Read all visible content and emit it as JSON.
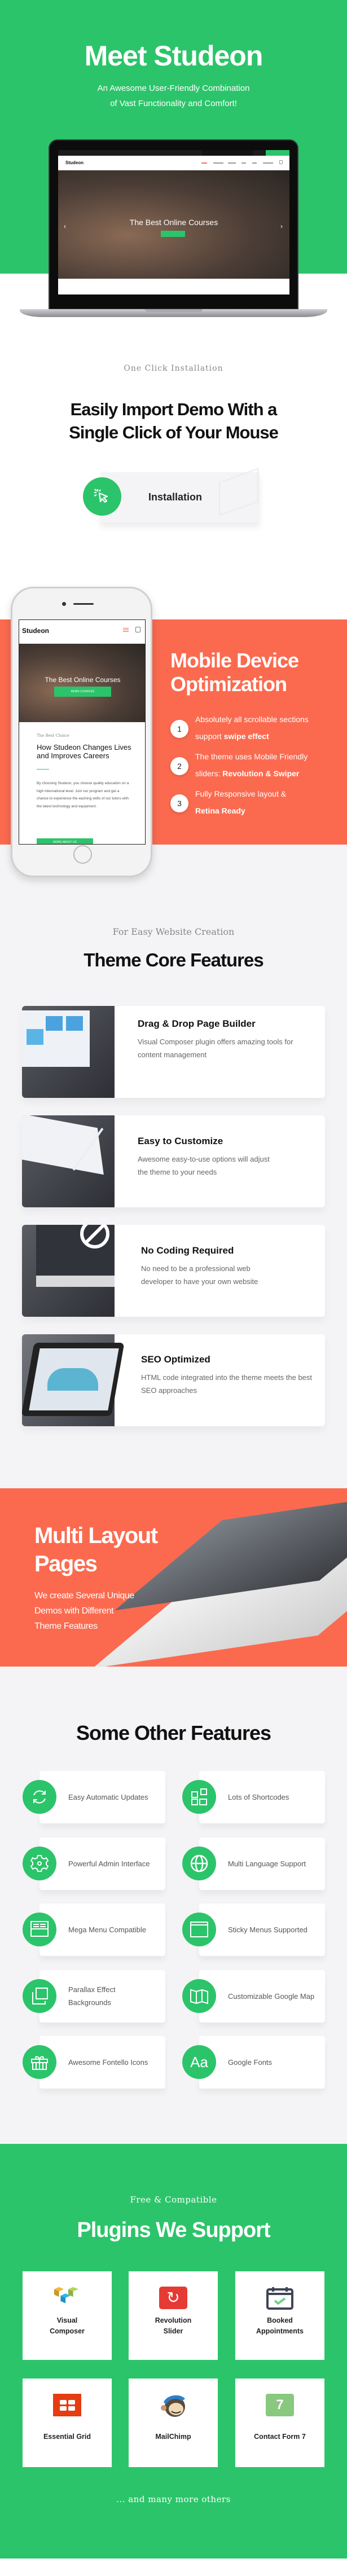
{
  "colors": {
    "green": "#2cc46a",
    "coral": "#fb6a4f",
    "background": "#f4f4f6"
  },
  "hero": {
    "title": "Meet Studeon",
    "subtitle_lines": [
      "An Awesome User-Friendly Combination",
      "of Vast Functionality  and Comfort!"
    ],
    "laptop": {
      "logo": "Studeon",
      "slide_title": "The Best Online Courses"
    }
  },
  "install": {
    "eyebrow": "One Click Installation",
    "heading_lines": [
      "Easily Import Demo With a",
      "Single Click of Your Mouse"
    ],
    "button_label": "Installation",
    "button_icon": "cursor-click-icon"
  },
  "mobile": {
    "phone": {
      "logo": "Studeon",
      "slide_title": "The Best Online Courses",
      "slide_button": "MORE COURCES",
      "eyebrow": "The Best Choice",
      "heading": "How Studeon Changes Lives and Improves Careers",
      "body": "By choosing Studeon, you choose quality education on a high international level. Join our program and get a chance to experience the eaching skills of our tutors with the latest technology and equipment.",
      "button": "MORE ABOUT US"
    },
    "title_lines": [
      "Mobile Device",
      "Optimization"
    ],
    "items": [
      {
        "num": "1",
        "text": "Absolutely all scrollable sections support ",
        "bold": "swipe effect"
      },
      {
        "num": "2",
        "text": "The theme uses Mobile Friendly sliders: ",
        "bold": "Revolution & Swiper"
      },
      {
        "num": "3",
        "text": "Fully Responsive layout & ",
        "bold": "Retina Ready"
      }
    ]
  },
  "core": {
    "eyebrow": "For Easy Website Creation",
    "title": "Theme Core Features",
    "cards": [
      {
        "title": "Drag & Drop Page Builder",
        "desc": "Visual  Composer plugin offers amazing tools for content management"
      },
      {
        "title": "Easy to Customize",
        "desc": "Awesome easy-to-use options will adjust the theme to your needs"
      },
      {
        "title": "No Coding Required",
        "desc": "No need to be a professional web developer to have your own website"
      },
      {
        "title": "SEO Optimized",
        "desc": "HTML code integrated into the theme meets the best SEO approaches"
      }
    ]
  },
  "multi": {
    "title_lines": [
      "Multi Layout",
      "Pages"
    ],
    "desc_lines": [
      "We create Several Unique",
      "Demos with Different",
      "Theme Features"
    ]
  },
  "other": {
    "title": "Some Other Features",
    "items": [
      {
        "label": "Easy Automatic Updates",
        "icon": "refresh-icon"
      },
      {
        "label": "Lots of Shortcodes",
        "icon": "shortcodes-icon"
      },
      {
        "label": "Powerful Admin Interface",
        "icon": "gear-icon"
      },
      {
        "label": "Multi Language Support",
        "icon": "globe-icon"
      },
      {
        "label": "Mega Menu Compatible",
        "icon": "mega-menu-icon"
      },
      {
        "label": "Sticky Menus Supported",
        "icon": "window-icon"
      },
      {
        "label": "Parallax Effect Backgrounds",
        "icon": "layers-icon"
      },
      {
        "label": "Customizable Google Map",
        "icon": "map-icon"
      },
      {
        "label": "Awesome Fontello Icons",
        "icon": "gift-icon"
      },
      {
        "label": "Google Fonts",
        "icon": "font-icon",
        "glyph": "Aa"
      }
    ]
  },
  "plugins": {
    "eyebrow": "Free & Compatible",
    "title": "Plugins We Support",
    "items": [
      {
        "name_lines": [
          "Visual",
          "Composer"
        ]
      },
      {
        "name_lines": [
          "Revolution",
          "Slider"
        ]
      },
      {
        "name_lines": [
          "Booked",
          "Appointments"
        ]
      },
      {
        "name_lines": [
          "Essential Grid"
        ]
      },
      {
        "name_lines": [
          "MailChimp"
        ]
      },
      {
        "name_lines": [
          "Contact Form 7"
        ],
        "logo_text": "7"
      }
    ],
    "footer": "... and many more others"
  }
}
